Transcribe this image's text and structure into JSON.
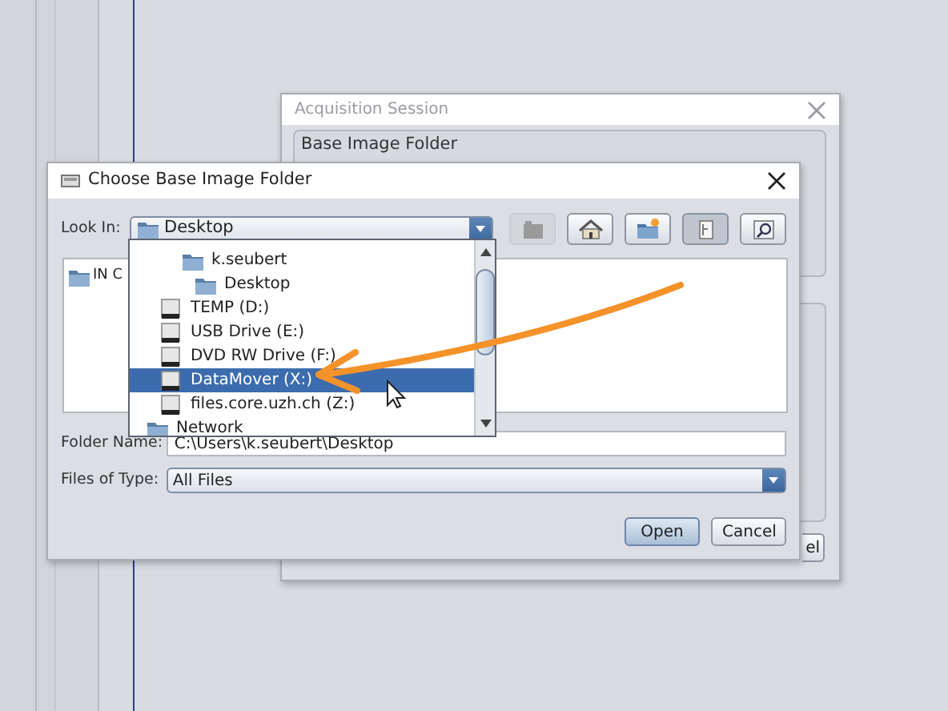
{
  "back_window": {
    "title": "Acquisition Session",
    "group_title": "Base Image Folder",
    "buttons": [
      "el"
    ]
  },
  "dialog": {
    "title": "Choose Base Image Folder",
    "look_in": {
      "label": "Look In:",
      "value": "Desktop"
    },
    "toolbar": [
      {
        "disabled": true,
        "selected": false
      },
      {
        "disabled": false,
        "selected": false
      },
      {
        "disabled": false,
        "selected": false
      },
      {
        "disabled": false,
        "selected": true
      },
      {
        "disabled": false,
        "selected": false
      }
    ],
    "files": [
      {
        "name": "IN C"
      }
    ],
    "folder_name": {
      "label": "Folder Name:",
      "value": "C:\\Users\\k.seubert\\Desktop"
    },
    "file_type": {
      "label": "Files of Type:",
      "value": "All Files"
    },
    "buttons": [
      {
        "label": "Open",
        "default": true
      },
      {
        "label": "Cancel",
        "default": false
      }
    ]
  },
  "popup": {
    "items": [
      {
        "name": "k.seubert",
        "kind": "folder",
        "selected": false,
        "children": [
          {
            "name": "Desktop",
            "kind": "folder",
            "selected": false
          }
        ]
      },
      {
        "name": "TEMP (D:)",
        "kind": "drive",
        "selected": false
      },
      {
        "name": "USB Drive (E:)",
        "kind": "drive",
        "selected": false
      },
      {
        "name": "DVD RW Drive (F:)",
        "kind": "drive",
        "selected": false
      },
      {
        "name": "DataMover (X:)",
        "kind": "drive",
        "selected": true
      },
      {
        "name": "files.core.uzh.ch (Z:)",
        "kind": "drive",
        "selected": false
      },
      {
        "name": "Network",
        "kind": "network",
        "selected": false
      }
    ]
  }
}
